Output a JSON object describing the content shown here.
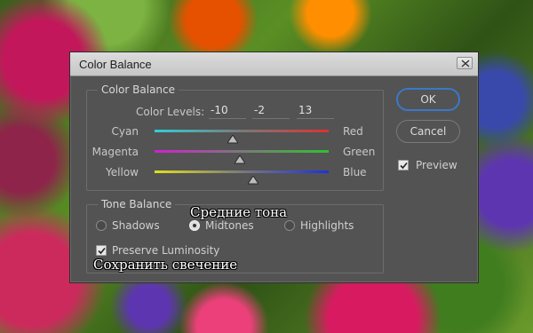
{
  "dialog": {
    "title": "Color Balance",
    "color_balance": {
      "group_label": "Color Balance",
      "levels_label": "Color Levels:",
      "levels": [
        "-10",
        "-2",
        "13"
      ],
      "sliders": [
        {
          "left": "Cyan",
          "right": "Red",
          "value": -10
        },
        {
          "left": "Magenta",
          "right": "Green",
          "value": -2
        },
        {
          "left": "Yellow",
          "right": "Blue",
          "value": 13
        }
      ]
    },
    "tone_balance": {
      "group_label": "Tone Balance",
      "options": [
        "Shadows",
        "Midtones",
        "Highlights"
      ],
      "selected": "Midtones",
      "preserve_label": "Preserve Luminosity",
      "preserve_checked": true
    },
    "buttons": {
      "ok": "OK",
      "cancel": "Cancel"
    },
    "preview_label": "Preview",
    "preview_checked": true
  },
  "overlays": {
    "midtones_ru": "Средние тона",
    "preserve_ru": "Сохранить свечение"
  },
  "colors": {
    "dialog_bg": "#535353",
    "ok_border": "#3a78c8"
  },
  "icons": [
    "close-icon",
    "check-icon",
    "slider-thumb-icon"
  ]
}
